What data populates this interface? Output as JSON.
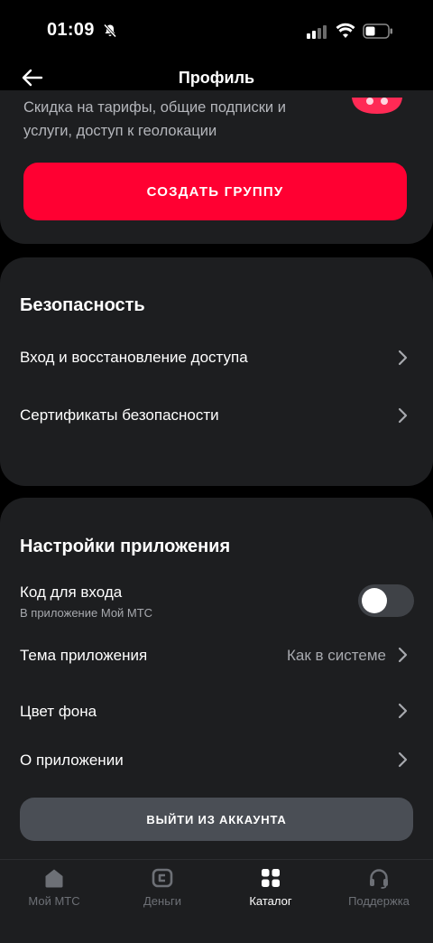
{
  "status_bar": {
    "time": "01:09"
  },
  "header": {
    "title": "Профиль"
  },
  "promo": {
    "text": "Скидка на тарифы, общие подписки и услуги, доступ к геолокации",
    "create_group_label": "СОЗДАТЬ ГРУППУ"
  },
  "security": {
    "title": "Безопасность",
    "items": [
      {
        "label": "Вход и восстановление доступа"
      },
      {
        "label": "Сертификаты безопасности"
      }
    ]
  },
  "app_settings": {
    "title": "Настройки приложения",
    "login_code": {
      "label": "Код для входа",
      "sublabel": "В приложение Мой МТС",
      "enabled": false
    },
    "theme": {
      "label": "Тема приложения",
      "value": "Как в системе"
    },
    "bg_color": {
      "label": "Цвет фона"
    },
    "about": {
      "label": "О приложении"
    },
    "logout_label": "ВЫЙТИ ИЗ АККАУНТА"
  },
  "nav": {
    "items": [
      {
        "label": "Мой МТС",
        "icon": "home-icon",
        "active": false
      },
      {
        "label": "Деньги",
        "icon": "wallet-icon",
        "active": false
      },
      {
        "label": "Каталог",
        "icon": "catalog-grid-icon",
        "active": true
      },
      {
        "label": "Поддержка",
        "icon": "headset-icon",
        "active": false
      }
    ]
  },
  "colors": {
    "accent": "#ff0032",
    "card": "#1d1e20",
    "background": "#000000"
  }
}
